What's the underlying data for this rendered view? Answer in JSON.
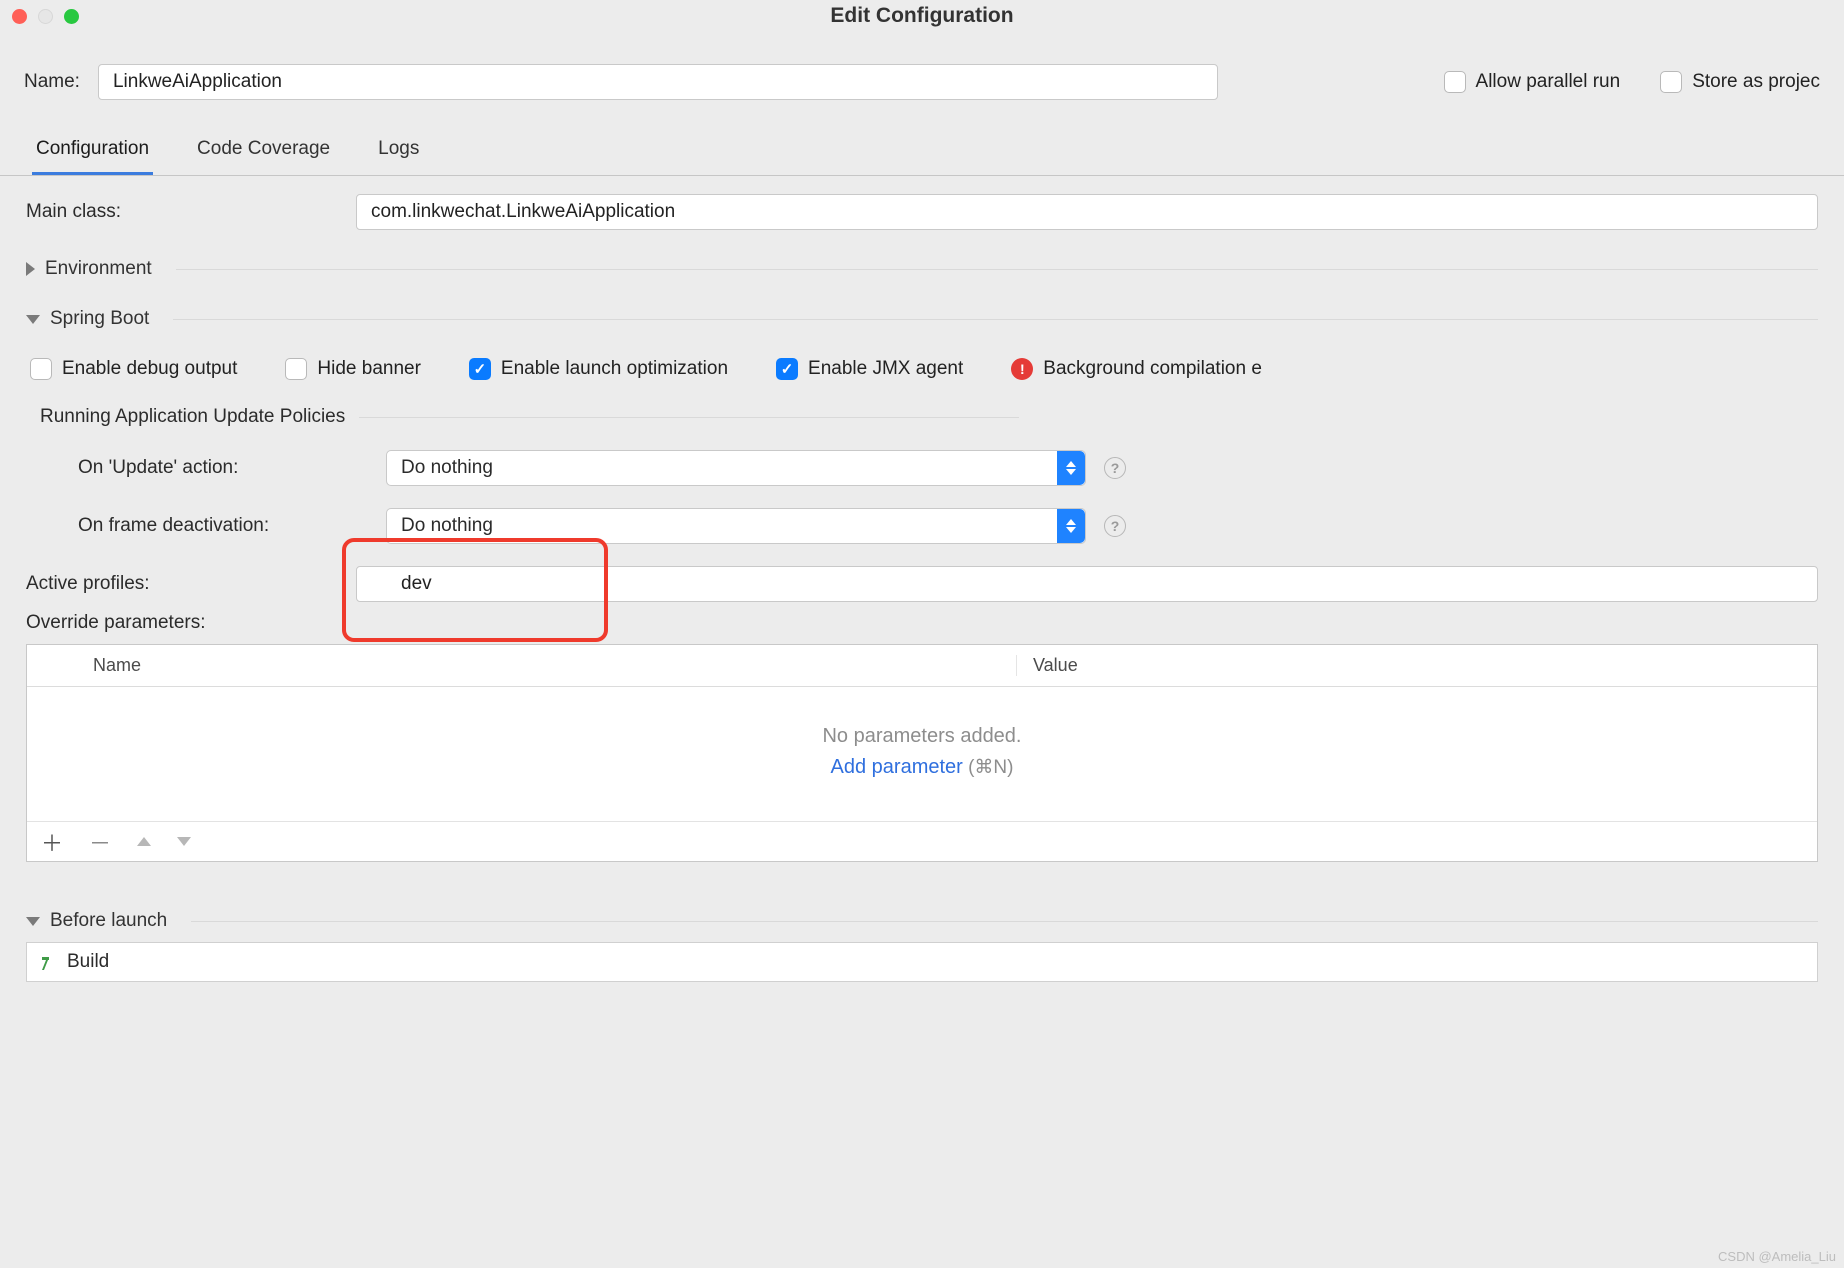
{
  "window": {
    "title": "Edit Configuration"
  },
  "name": {
    "label": "Name:",
    "value": "LinkweAiApplication"
  },
  "flags": {
    "allow_parallel": "Allow parallel run",
    "store_as_project": "Store as projec",
    "allow_parallel_checked": false,
    "store_as_project_checked": false
  },
  "tabs": {
    "configuration": "Configuration",
    "coverage": "Code Coverage",
    "logs": "Logs"
  },
  "main_class": {
    "label": "Main class:",
    "value": "com.linkwechat.LinkweAiApplication"
  },
  "sections": {
    "environment": "Environment",
    "spring_boot": "Spring Boot",
    "before_launch": "Before launch"
  },
  "spring": {
    "enable_debug": "Enable debug output",
    "hide_banner": "Hide banner",
    "enable_launch_opt": "Enable launch optimization",
    "enable_jmx": "Enable JMX agent",
    "bg_compile": "Background compilation e"
  },
  "policies": {
    "title": "Running Application Update Policies",
    "on_update_label": "On 'Update' action:",
    "on_update_value": "Do nothing",
    "on_frame_label": "On frame deactivation:",
    "on_frame_value": "Do nothing"
  },
  "profiles": {
    "label": "Active profiles:",
    "value": "dev"
  },
  "override": {
    "label": "Override parameters:",
    "col_name": "Name",
    "col_value": "Value",
    "empty_hint": "No parameters added.",
    "add_link": "Add parameter",
    "shortcut": " (⌘N)"
  },
  "build": {
    "label": "Build"
  },
  "watermark": "CSDN @Amelia_Liu"
}
